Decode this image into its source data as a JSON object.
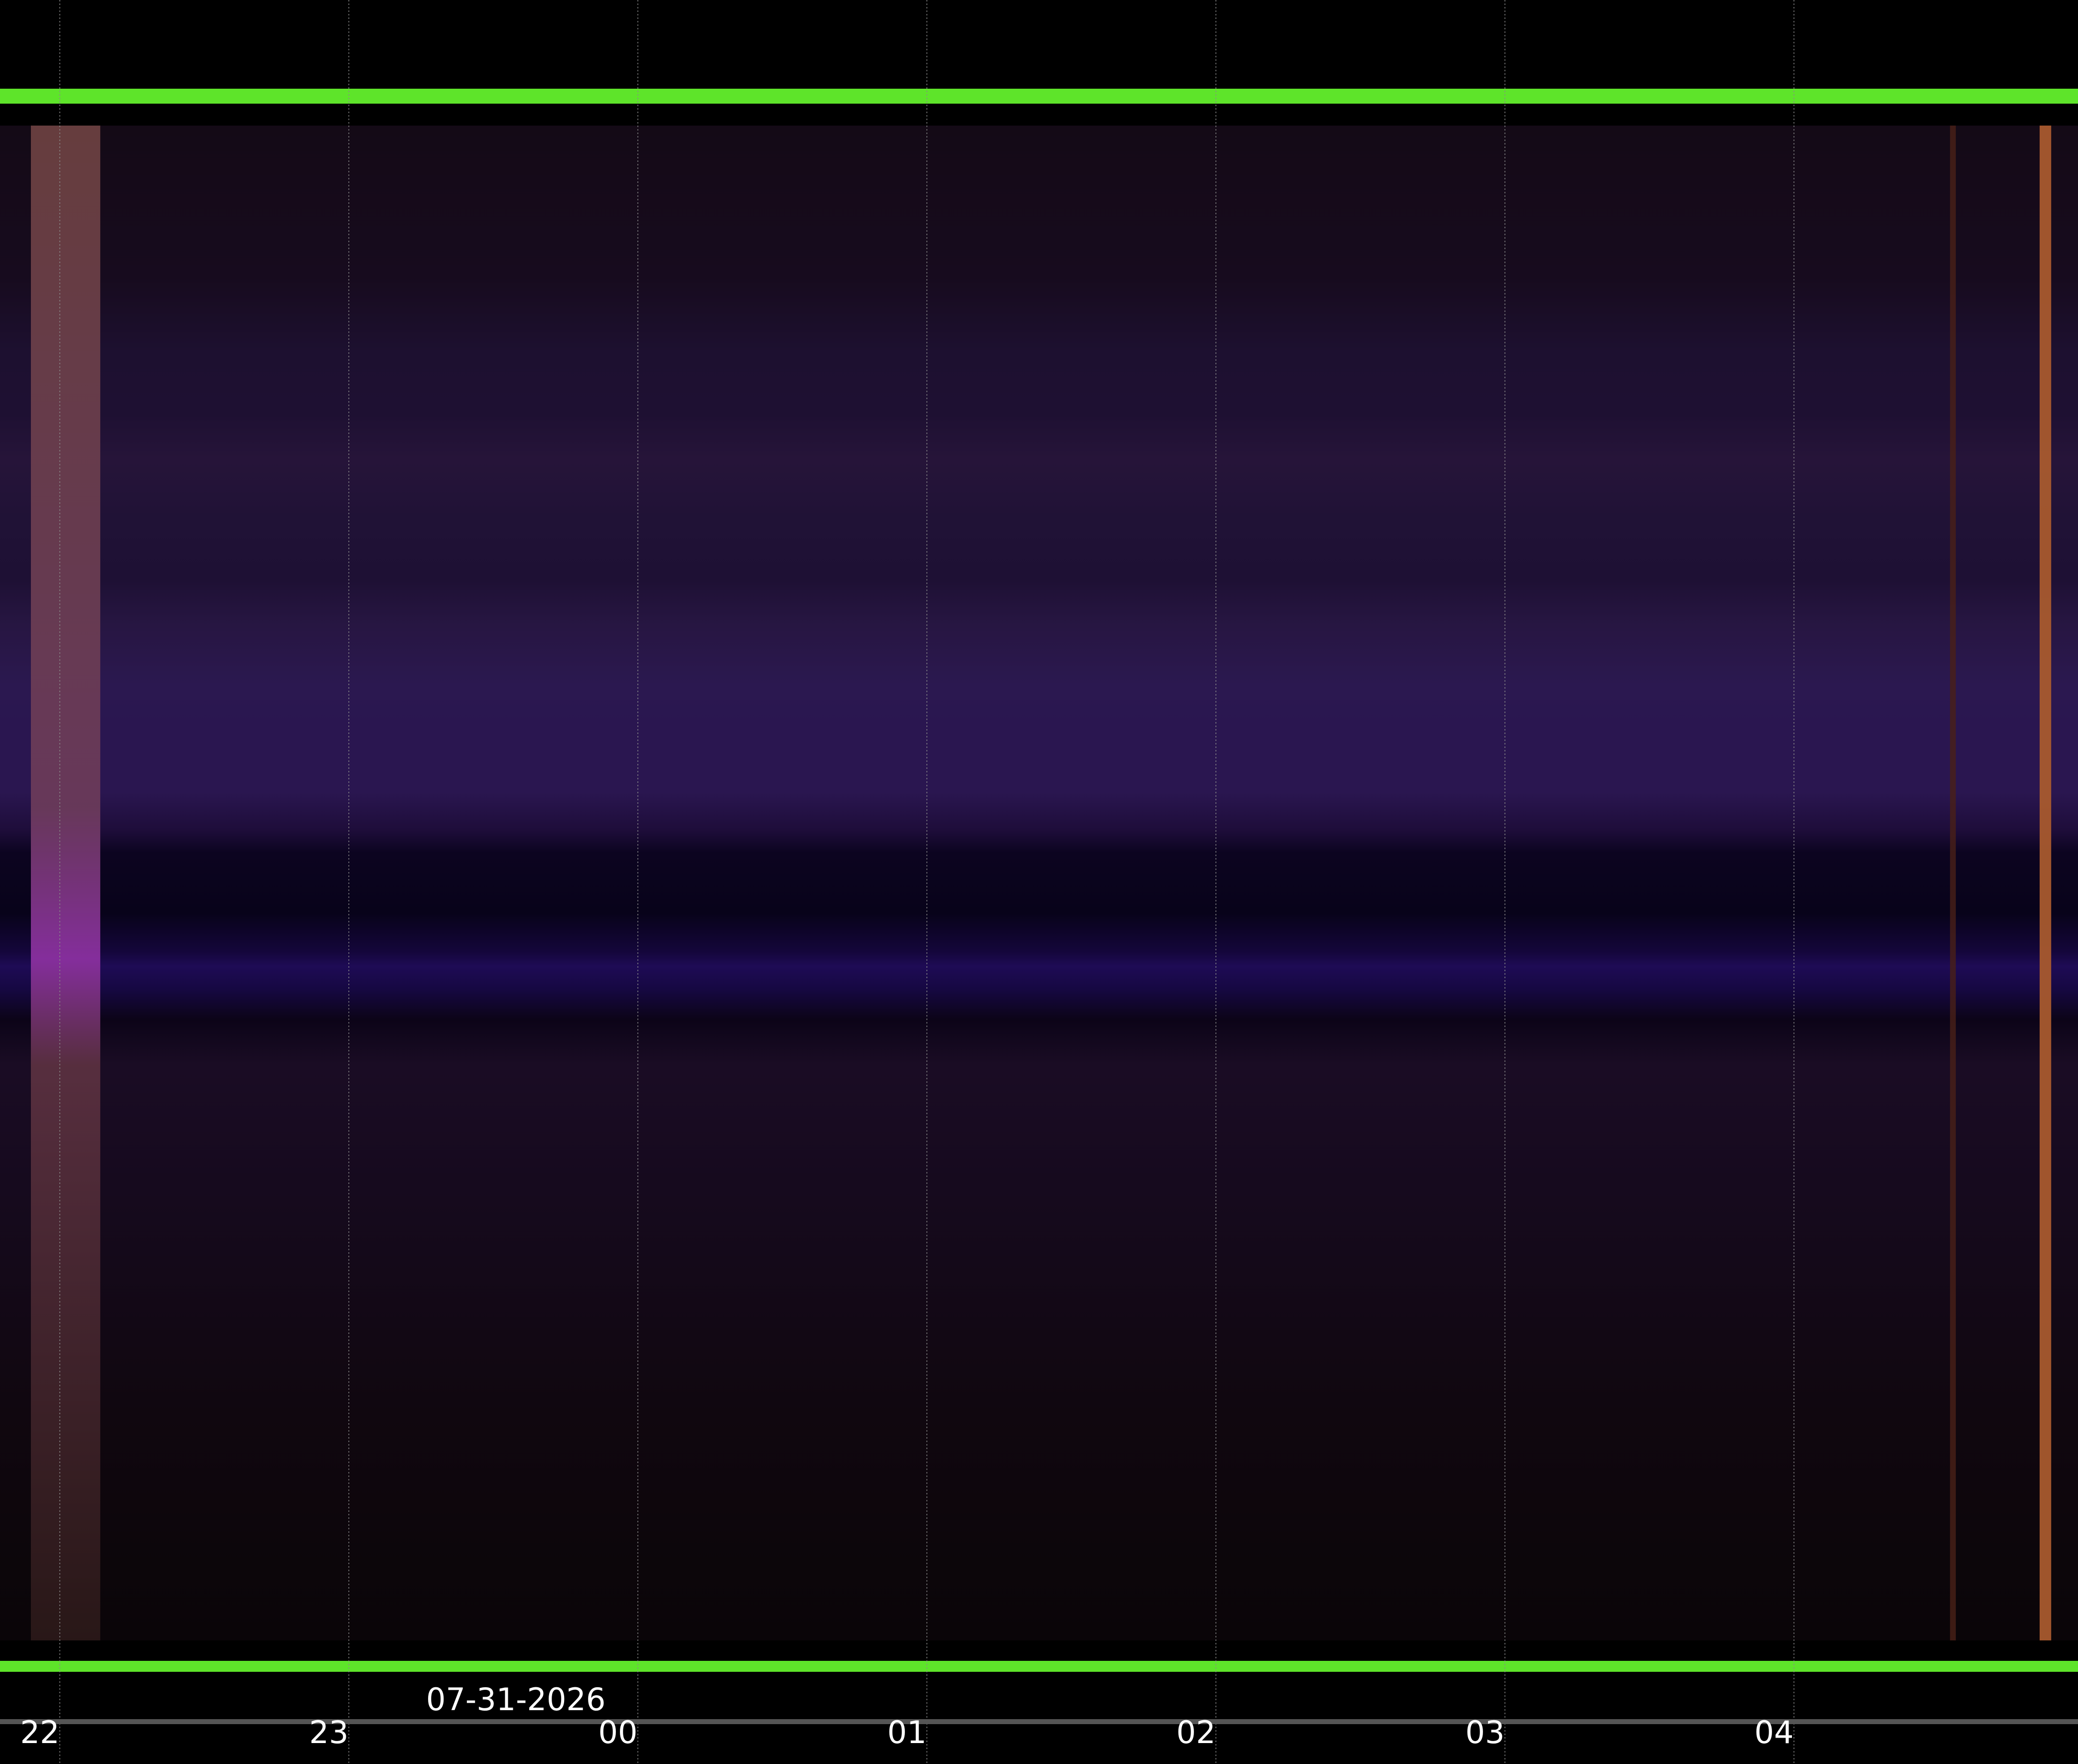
{
  "chart_data": {
    "type": "heatmap",
    "date_label": "07-31-2026",
    "x_ticks": [
      "22",
      "23",
      "00",
      "01",
      "02",
      "03",
      "04"
    ],
    "grid": true,
    "colors": {
      "background": "#000000",
      "border": "#5ee42a",
      "gridline": "#8a8a8a",
      "timeline": "#555555",
      "text": "#ffffff"
    },
    "bands": [
      {
        "pos": 0.0,
        "color": "#140a16"
      },
      {
        "pos": 0.1,
        "color": "#170b1e"
      },
      {
        "pos": 0.15,
        "color": "#1d1030"
      },
      {
        "pos": 0.19,
        "color": "#1e1032"
      },
      {
        "pos": 0.22,
        "color": "#261439"
      },
      {
        "pos": 0.26,
        "color": "#201236"
      },
      {
        "pos": 0.3,
        "color": "#1e1034"
      },
      {
        "pos": 0.33,
        "color": "#271642"
      },
      {
        "pos": 0.37,
        "color": "#2b1850"
      },
      {
        "pos": 0.4,
        "color": "#2a1650"
      },
      {
        "pos": 0.44,
        "color": "#2a1650"
      },
      {
        "pos": 0.465,
        "color": "#1e0d3a"
      },
      {
        "pos": 0.48,
        "color": "#0c0420"
      },
      {
        "pos": 0.52,
        "color": "#08031a"
      },
      {
        "pos": 0.545,
        "color": "#14063a"
      },
      {
        "pos": 0.555,
        "color": "#1e0b55"
      },
      {
        "pos": 0.57,
        "color": "#160842"
      },
      {
        "pos": 0.59,
        "color": "#0c0418"
      },
      {
        "pos": 0.62,
        "color": "#1a0c24"
      },
      {
        "pos": 0.7,
        "color": "#160a1e"
      },
      {
        "pos": 0.85,
        "color": "#10070f"
      },
      {
        "pos": 1.0,
        "color": "#0a0508"
      }
    ],
    "features": [
      {
        "name": "twilight-edge",
        "x_hours": -0.1,
        "x_end_hours": 0.14,
        "color": "#5a3a40"
      },
      {
        "name": "flash-faint",
        "x_hours": 6.54,
        "x_end_hours": 6.56,
        "color": "#4a2018"
      },
      {
        "name": "flash-bright",
        "x_hours": 6.85,
        "x_end_hours": 6.89,
        "color": "#a85a2e"
      }
    ]
  }
}
